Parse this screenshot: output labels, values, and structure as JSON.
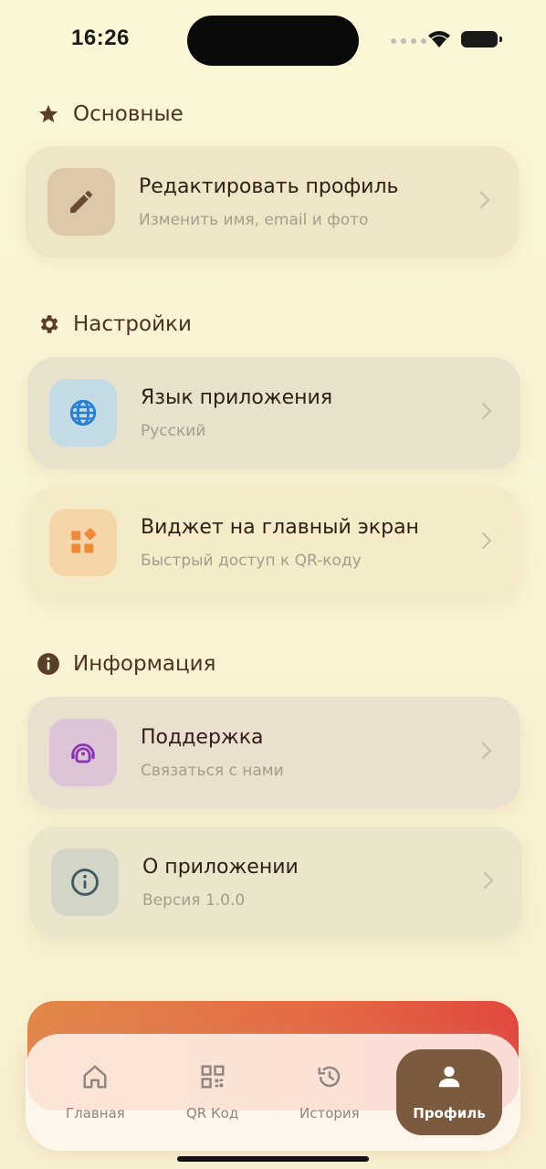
{
  "status_bar": {
    "time": "16:26"
  },
  "sections": {
    "main": {
      "title": "Основные",
      "items": [
        {
          "title": "Редактировать профиль",
          "subtitle": "Изменить имя, email и фото",
          "icon": "pencil-icon",
          "color": "#6b4b36"
        }
      ]
    },
    "settings": {
      "title": "Настройки",
      "items": [
        {
          "title": "Язык приложения",
          "subtitle": "Русский",
          "icon": "globe-icon",
          "color": "#2a7fd4"
        },
        {
          "title": "Виджет на главный экран",
          "subtitle": "Быстрый доступ к QR-коду",
          "icon": "widgets-icon",
          "color": "#f08a3a"
        }
      ]
    },
    "info": {
      "title": "Информация",
      "items": [
        {
          "title": "Поддержка",
          "subtitle": "Связаться с нами",
          "icon": "support-icon",
          "color": "#8b35b3"
        },
        {
          "title": "О приложении",
          "subtitle": "Версия 1.0.0",
          "icon": "info-circle-icon",
          "color": "#3f5866"
        }
      ]
    }
  },
  "tab_bar": {
    "tabs": [
      {
        "label": "Главная",
        "icon": "home-icon",
        "active": false
      },
      {
        "label": "QR Код",
        "icon": "qr-code-icon",
        "active": false
      },
      {
        "label": "История",
        "icon": "history-icon",
        "active": false
      },
      {
        "label": "Профиль",
        "icon": "person-icon",
        "active": true
      }
    ]
  },
  "colors": {
    "background": "#fbf6d6",
    "accent": "#7b5a3e",
    "logout_gradient_start": "#e3874a",
    "logout_gradient_end": "#e2473f"
  }
}
